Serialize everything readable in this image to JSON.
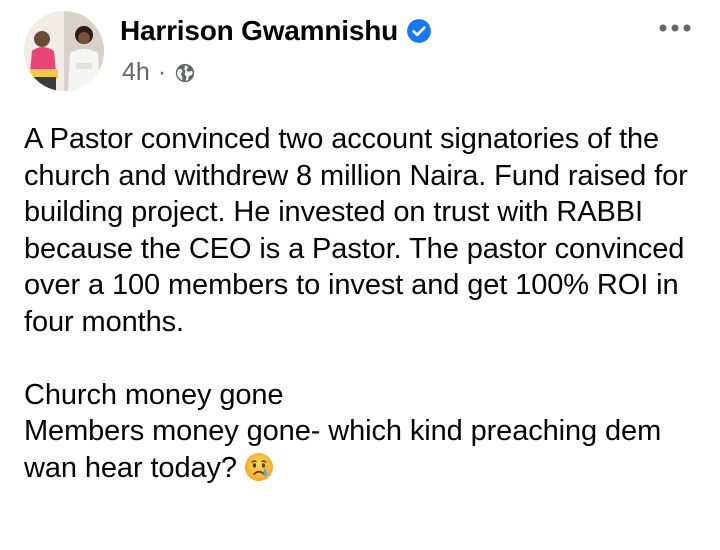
{
  "post": {
    "author": {
      "name": "Harrison Gwamnishu",
      "verified": true,
      "verified_icon": "verified-badge-icon",
      "avatar_icon": "avatar"
    },
    "meta": {
      "time": "4h",
      "separator": "·",
      "audience_icon": "globe-icon"
    },
    "more_icon": "more-options-icon",
    "body": {
      "paragraph_1": "A Pastor convinced two account signatories of the church and withdrew 8 million Naira. Fund raised for  building project. He invested on trust with RABBI because the CEO is a Pastor. The pastor convinced over a 100 members to invest and get 100% ROI in four months.",
      "line_1": "Church money gone",
      "line_2": "Members money gone- which kind preaching dem wan hear today?",
      "emoji": "crying-face-emoji"
    }
  },
  "colors": {
    "text": "#050505",
    "secondary": "#65676b",
    "verified_blue": "#1877f2",
    "background": "#ffffff"
  }
}
